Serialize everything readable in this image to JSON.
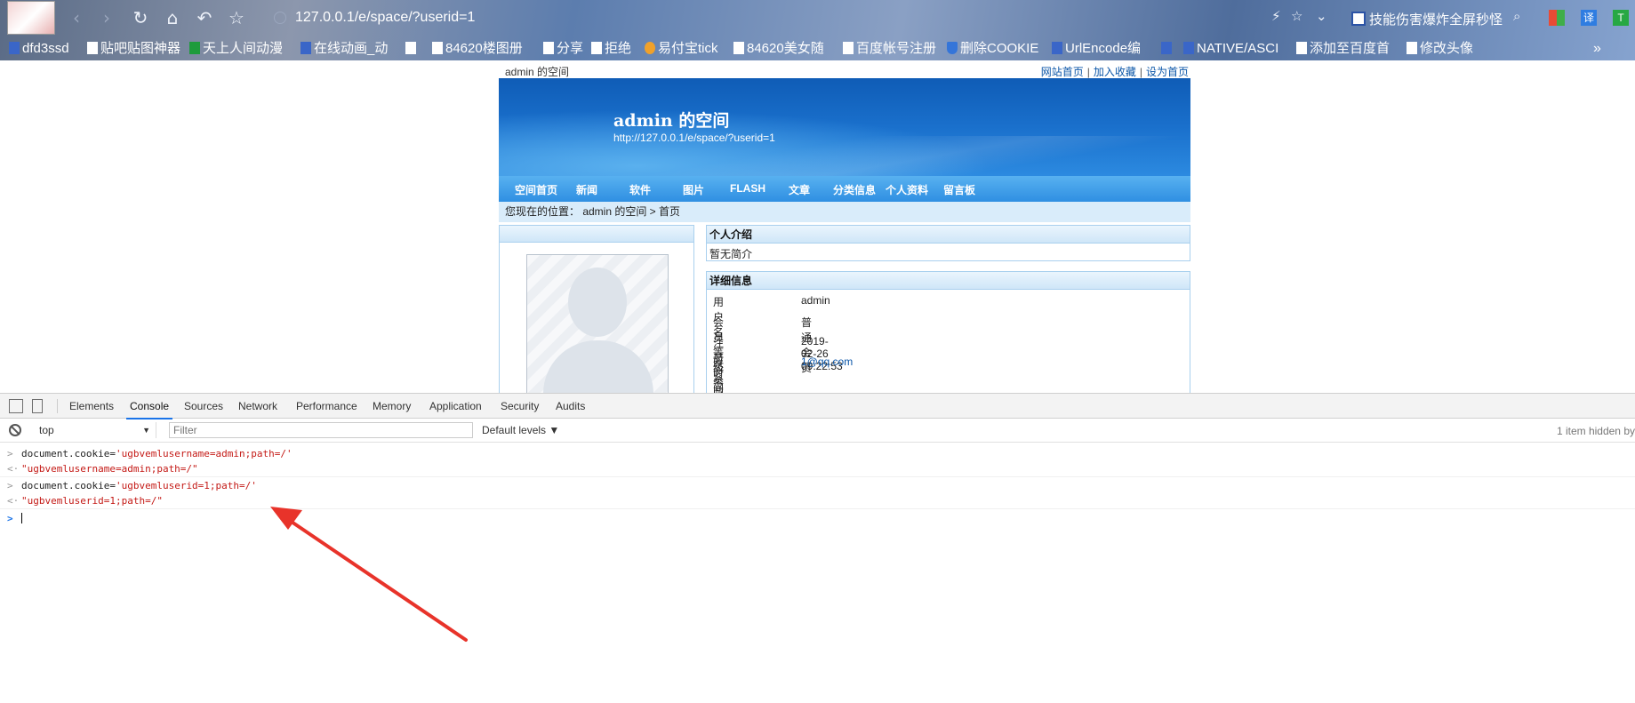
{
  "browser": {
    "url": "127.0.0.1/e/space/?userid=1",
    "promo_text": "技能伤害爆炸全屏秒怪",
    "translate_label": "译"
  },
  "bookmarks": [
    "dfd3ssd",
    "贴吧贴图神器",
    "天上人间动漫",
    "在线动画_动",
    "84620楼图册",
    "分享",
    "拒绝",
    "易付宝tick",
    "84620美女随",
    "百度帐号注册",
    "删除COOKIE",
    "UrlEncode编",
    "NATIVE/ASCI",
    "添加至百度首",
    "修改头像"
  ],
  "page": {
    "topbar_left": "admin 的空间",
    "topbar_links": [
      "网站首页",
      "加入收藏",
      "设为首页"
    ],
    "topbar_sep": "|",
    "banner_title": "admin 的空间",
    "banner_url": "http://127.0.0.1/e/space/?userid=1",
    "nav": [
      "空间首页",
      "新闻",
      "软件",
      "图片",
      "FLASH",
      "文章",
      "分类信息",
      "个人资料",
      "留言板"
    ],
    "breadcrumb": "您现在的位置： admin 的空间 > 首页",
    "intro_title": "个人介绍",
    "intro_text": "暂无简介",
    "detail_title": "详细信息",
    "details": [
      {
        "key": "用户名",
        "value": "admin"
      },
      {
        "key": "会员等级",
        "value": "普通会员"
      },
      {
        "key": "注册时间",
        "value": "2019-02-26 09:22:53"
      },
      {
        "key": "联系邮箱",
        "value": "1@qq.com"
      },
      {
        "key": "签名",
        "value": ""
      }
    ]
  },
  "devtools": {
    "tabs": [
      "Elements",
      "Console",
      "Sources",
      "Network",
      "Performance",
      "Memory",
      "Application",
      "Security",
      "Audits"
    ],
    "active_tab": "Console",
    "context": "top",
    "filter_placeholder": "Filter",
    "levels": "Default levels ▼",
    "hidden_items": "1 item hidden by",
    "console_lines": [
      {
        "type": "input",
        "prefix": "document.cookie=",
        "string": "'ugbvemlusername=admin;path=/'"
      },
      {
        "type": "result",
        "text": "\"ugbvemlusername=admin;path=/\""
      },
      {
        "type": "input",
        "prefix": "document.cookie=",
        "string": "'ugbvemluserid=1;path=/'"
      },
      {
        "type": "result",
        "text": "\"ugbvemluserid=1;path=/\""
      }
    ],
    "annotation_color": "#e8332a"
  }
}
